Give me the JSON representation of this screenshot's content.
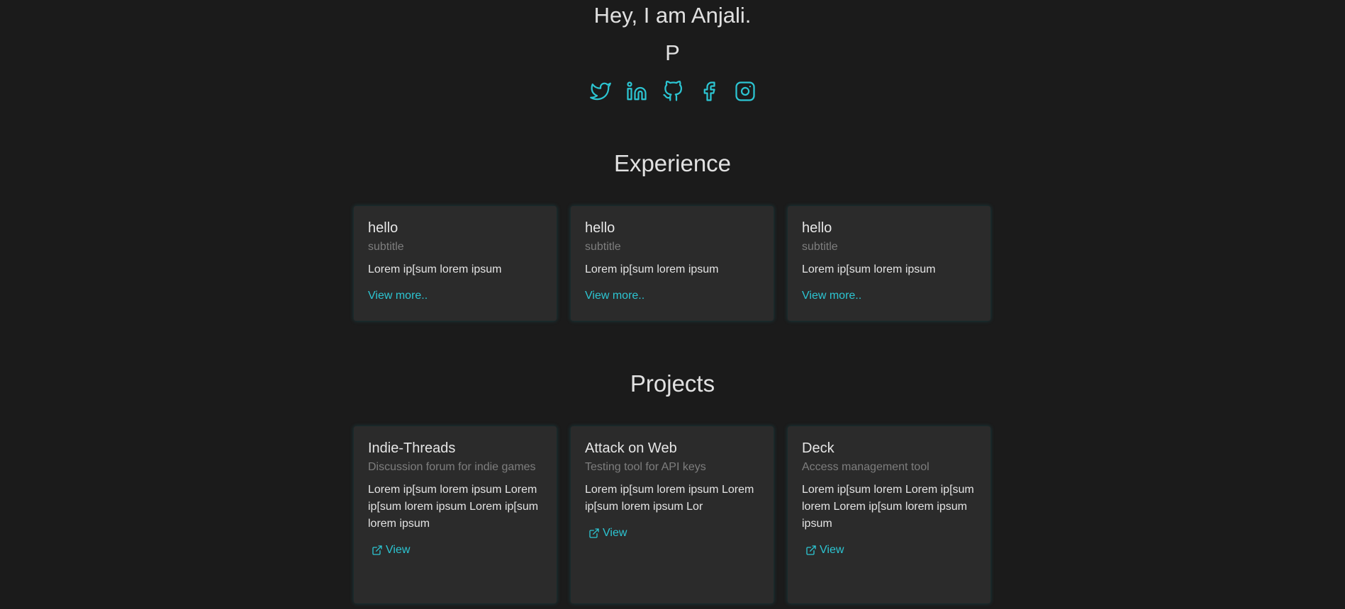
{
  "header": {
    "greeting": "Hey, I am Anjali.",
    "tagline": "P"
  },
  "socials": [
    {
      "name": "twitter-icon"
    },
    {
      "name": "linkedin-icon"
    },
    {
      "name": "github-icon"
    },
    {
      "name": "facebook-icon"
    },
    {
      "name": "instagram-icon"
    }
  ],
  "colors": {
    "background": "#1b1b1b",
    "card": "#2b2b2b",
    "accent": "#2cc5d2",
    "muted": "#7e7e7e"
  },
  "experience": {
    "title": "Experience",
    "cards": [
      {
        "title": "hello",
        "subtitle": "subtitle",
        "body": "Lorem ip[sum lorem ipsum",
        "link": "View more.."
      },
      {
        "title": "hello",
        "subtitle": "subtitle",
        "body": "Lorem ip[sum lorem ipsum",
        "link": "View more.."
      },
      {
        "title": "hello",
        "subtitle": "subtitle",
        "body": "Lorem ip[sum lorem ipsum",
        "link": "View more.."
      }
    ]
  },
  "projects": {
    "title": "Projects",
    "cards": [
      {
        "title": "Indie-Threads",
        "subtitle": "Discussion forum for indie games",
        "body": "Lorem ip[sum lorem ipsum Lorem ip[sum lorem ipsum Lorem ip[sum lorem ipsum",
        "link": "View"
      },
      {
        "title": "Attack on Web",
        "subtitle": "Testing tool for API keys",
        "body": "Lorem ip[sum lorem ipsum Lorem ip[sum lorem ipsum Lor",
        "link": "View"
      },
      {
        "title": "Deck",
        "subtitle": "Access management tool",
        "body": "Lorem ip[sum lorem Lorem ip[sum lorem Lorem ip[sum lorem ipsum ipsum",
        "link": "View"
      }
    ]
  }
}
